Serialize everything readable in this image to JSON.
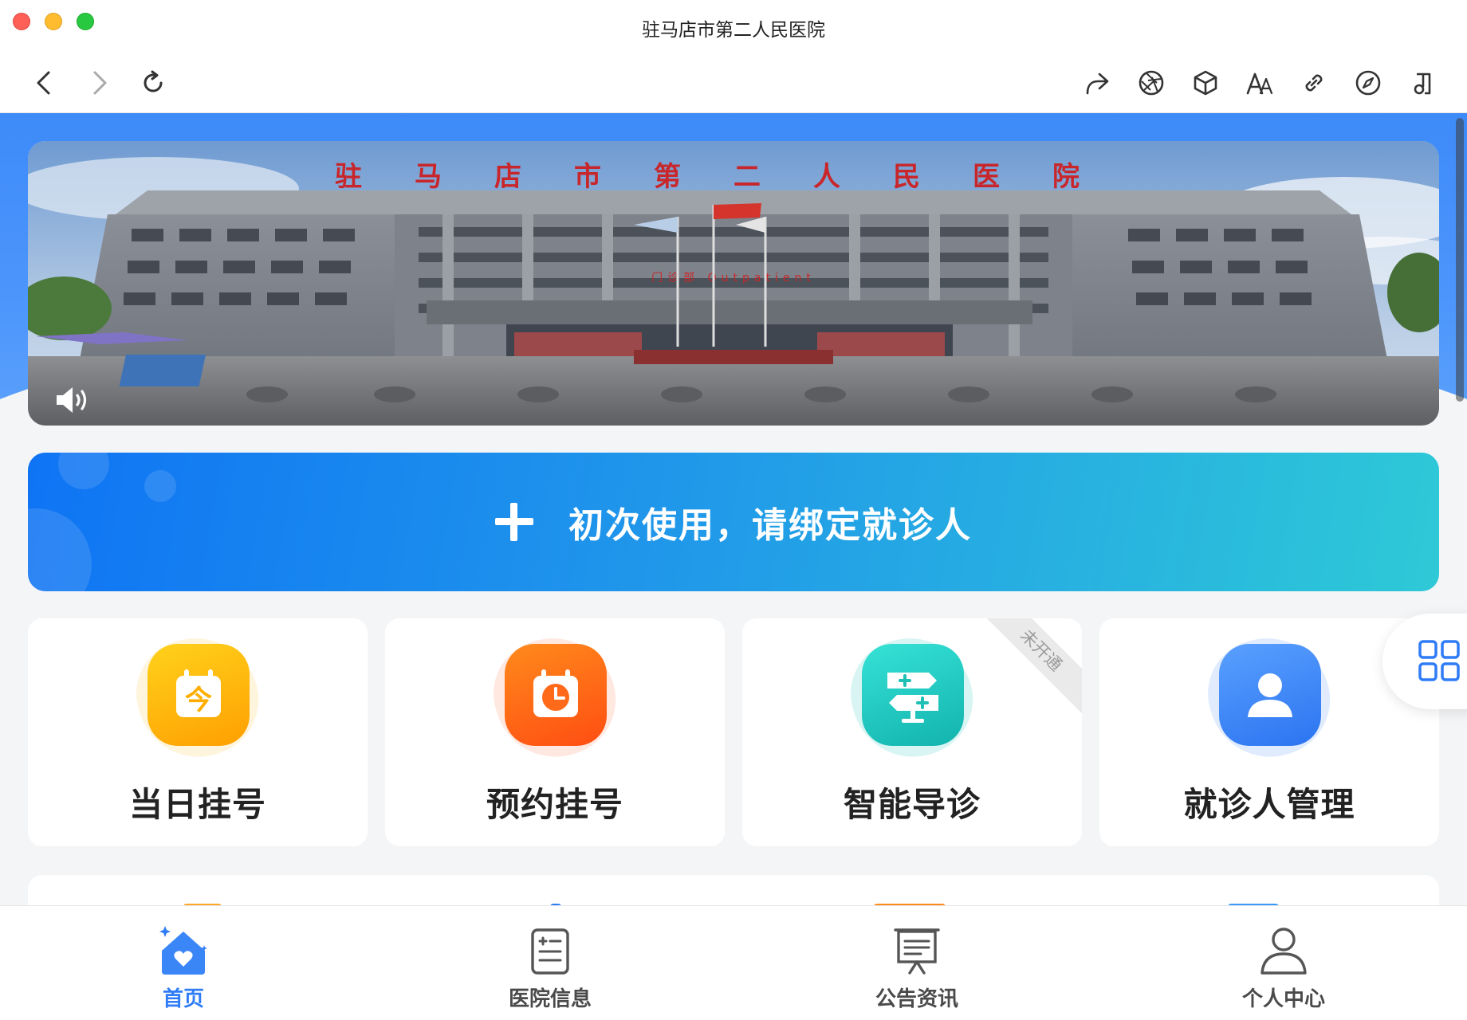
{
  "window": {
    "title": "驻马店市第二人民医院"
  },
  "toolbar": {
    "nav_icons": [
      "chevron-left-icon",
      "chevron-right-icon",
      "reload-icon"
    ],
    "action_icons": [
      "share-icon",
      "aperture-icon",
      "cube-icon",
      "text-size-icon",
      "link-icon",
      "compass-icon",
      "music-note-icon"
    ]
  },
  "banner": {
    "sign_text": "驻马店市第二人民医院",
    "sub_sign_text": "门诊部 Outpatient",
    "volume_icon": "speaker-icon"
  },
  "bind_card": {
    "label": "初次使用，请绑定就诊人",
    "icon": "plus-icon"
  },
  "functions": [
    {
      "label": "当日挂号",
      "icon": "today-calendar-icon",
      "glyph": "今",
      "color": "#ffb300"
    },
    {
      "label": "预约挂号",
      "icon": "calendar-clock-icon",
      "color": "#ff6a1a"
    },
    {
      "label": "智能导诊",
      "icon": "signpost-icon",
      "color": "#1ec9c0",
      "ribbon": "未开通"
    },
    {
      "label": "就诊人管理",
      "icon": "person-icon",
      "color": "#3a86f7"
    }
  ],
  "tabbar": {
    "tabs": [
      {
        "label": "首页",
        "icon": "home-heart-icon",
        "active": true
      },
      {
        "label": "医院信息",
        "icon": "hospital-info-icon",
        "active": false
      },
      {
        "label": "公告资讯",
        "icon": "announcement-board-icon",
        "active": false
      },
      {
        "label": "个人中心",
        "icon": "user-profile-icon",
        "active": false
      }
    ]
  },
  "colors": {
    "accent": "#2f7cf6",
    "header_blue": "#3d8bf9",
    "bind_gradient_start": "#0f74f4",
    "bind_gradient_end": "#2ec9d7"
  }
}
